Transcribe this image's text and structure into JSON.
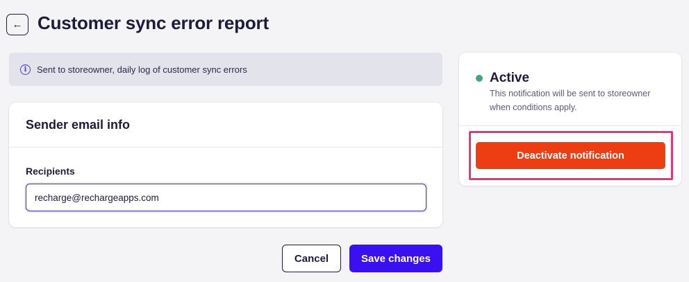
{
  "header": {
    "back_icon": "←",
    "title": "Customer sync error report"
  },
  "info_banner": {
    "icon": "i",
    "text": "Sent to storeowner, daily log of customer sync errors"
  },
  "sender_card": {
    "title": "Sender email info",
    "recipients_label": "Recipients",
    "recipients_value": "recharge@rechargeapps.com"
  },
  "footer": {
    "cancel_label": "Cancel",
    "save_label": "Save changes"
  },
  "status_card": {
    "status": "Active",
    "description": "This notification will be sent to storeowner when conditions apply.",
    "deactivate_label": "Deactivate notification"
  },
  "colors": {
    "primary": "#3a0ff0",
    "danger": "#ec3d13",
    "active": "#4b9f84",
    "highlight": "#e8347a"
  }
}
